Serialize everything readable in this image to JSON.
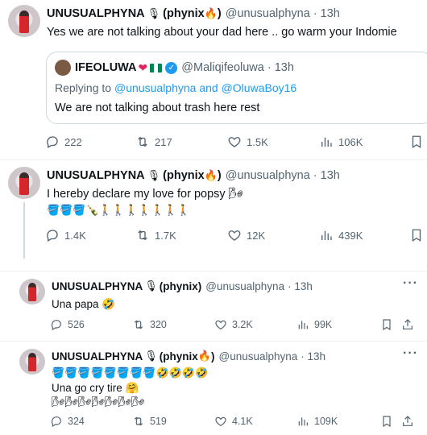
{
  "colors": {
    "accent": "#1d9bf0",
    "text": "#0f1419",
    "muted": "#536471",
    "border": "#cfd9de"
  },
  "tweets": [
    {
      "name": "UNUSUALPHYNA",
      "name_suffix": "(phynix",
      "name_end": ")",
      "handle": "@unusualphyna",
      "time": "· 13h",
      "text": "Yes we are not talking about your dad here .. go warm your Indomie",
      "quote": {
        "name": "IFEOLUWA",
        "handle": "@Maliqifeoluwa",
        "time": "· 13h",
        "replying_prefix": "Replying to",
        "replying_to": "@unusualphyna and @OluwaBoy16",
        "text": "We are not talking about trash here rest"
      },
      "replies": "222",
      "reposts": "217",
      "likes": "1.5K",
      "views": "106K"
    },
    {
      "name": "UNUSUALPHYNA",
      "name_suffix": "(phynix",
      "name_end": ")",
      "handle": "@unusualphyna",
      "time": "· 13h",
      "text": "I hereby declare my love for popsy 🌬",
      "emoji_line": "🪣🪣🪣🍾🚶🚶🚶🚶🚶🚶🚶",
      "replies": "1.4K",
      "reposts": "1.7K",
      "likes": "12K",
      "views": "439K"
    },
    {
      "name": "UNUSUALPHYNA",
      "name_suffix": "(phynix",
      "name_end": ")",
      "handle": "@unusualphyna",
      "time": "· 13h",
      "text": "Una papa 🤣",
      "replies": "526",
      "reposts": "320",
      "likes": "3.2K",
      "views": "99K"
    },
    {
      "name": "UNUSUALPHYNA",
      "name_suffix": "(phynix",
      "name_end": ")",
      "handle": "@unusualphyna",
      "time": "· 13h",
      "emoji_line": "🪣🪣🪣🪣🪣🪣🪣🪣🤣🤣🤣🤣",
      "text": "Una go cry tire 🤗",
      "emoji_line2": "🌬🌬🌬🌬🌬🌬🌬",
      "replies": "324",
      "reposts": "519",
      "likes": "4.1K",
      "views": "109K"
    }
  ],
  "icons": {
    "reply": "reply-icon",
    "repost": "repost-icon",
    "like": "heart-icon",
    "views": "views-icon",
    "bookmark": "bookmark-icon",
    "share": "share-icon",
    "more": "more-icon",
    "mic": "microphone-icon",
    "fire": "fire-icon"
  }
}
